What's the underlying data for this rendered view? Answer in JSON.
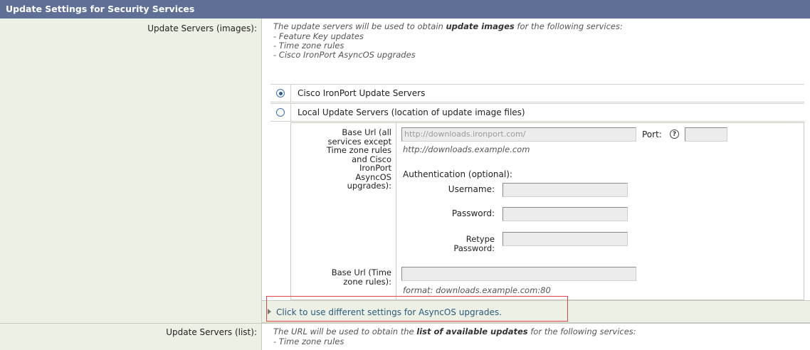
{
  "header": {
    "title": "Update Settings for Security Services"
  },
  "update_servers_images": {
    "label": "Update Servers (images):",
    "description_prefix": "The update servers will be used to obtain ",
    "description_bold": "update images",
    "description_suffix": " for the following services:",
    "services": [
      "- Feature Key updates",
      "- Time zone rules",
      "- Cisco IronPort AsyncOS upgrades"
    ],
    "options": [
      {
        "label": "Cisco IronPort Update Servers",
        "selected": true
      },
      {
        "label": "Local Update Servers (location of update image files)",
        "selected": false
      }
    ],
    "base_url_label_lines": [
      "Base Url (all",
      "services except",
      "Time zone rules",
      "and Cisco",
      "IronPort",
      "AsyncOS",
      "upgrades):"
    ],
    "base_url_value": "http://downloads.ironport.com/",
    "base_url_hint": "http://downloads.example.com",
    "port_label": "Port:",
    "port_value": "",
    "auth_label": "Authentication (optional):",
    "username_label": "Username:",
    "password_label": "Password:",
    "retype_label_lines": [
      "Retype",
      "Password:"
    ],
    "time_zone_label_lines": [
      "Base Url (Time",
      "zone rules):"
    ],
    "time_zone_value": "",
    "time_zone_hint": "format: downloads.example.com:80",
    "advanced_link": "Click to use different settings for AsyncOS upgrades."
  },
  "update_servers_list": {
    "label": "Update Servers (list):",
    "description_prefix": "The URL will be used to obtain the ",
    "description_bold": "list of available updates",
    "description_suffix": " for the following services:",
    "services": [
      "- Time zone rules"
    ]
  },
  "colors": {
    "title_bar": "#5f6f95",
    "label_bg": "#edf0e4",
    "highlight": "#e34545"
  }
}
